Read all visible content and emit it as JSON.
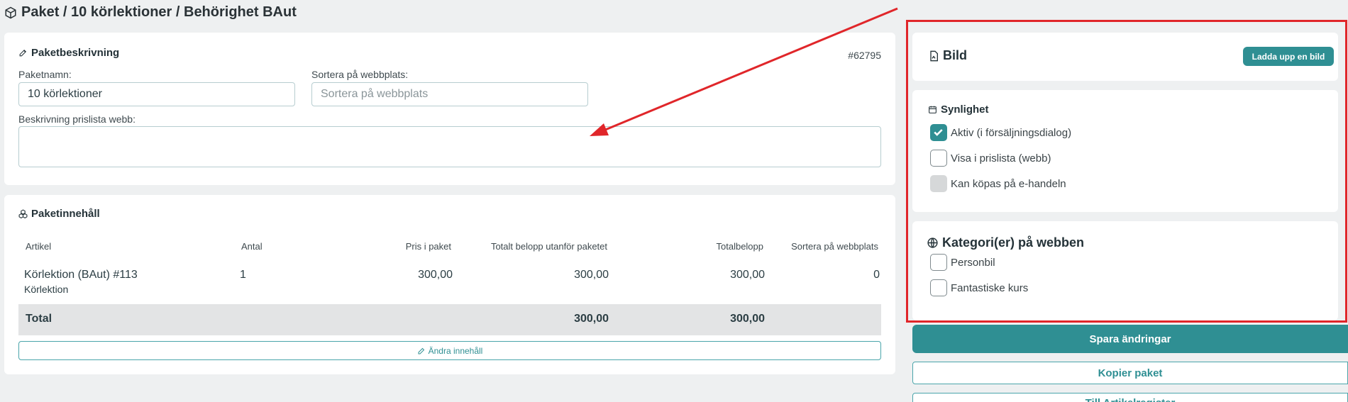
{
  "header": {
    "breadcrumb": "Paket / 10 körlektioner / Behörighet BAut"
  },
  "description": {
    "title": "Paketbeskrivning",
    "id": "#62795",
    "name_label": "Paketnamn:",
    "name_value": "10 körlektioner",
    "sort_label": "Sortera på webbplats:",
    "sort_placeholder": "Sortera på webbplats",
    "desc_label": "Beskrivning prislista webb:",
    "desc_value": ""
  },
  "content": {
    "title": "Paketinnehåll",
    "columns": [
      "Artikel",
      "Antal",
      "Pris i paket",
      "Totalt belopp utanför paketet",
      "Totalbelopp",
      "Sortera på webbplats"
    ],
    "row": {
      "article": "Körlektion (BAut) #113",
      "article_sub": "Körlektion",
      "qty": "1",
      "price": "300,00",
      "outside_total": "300,00",
      "total": "300,00",
      "sort": "0"
    },
    "total_label": "Total",
    "total_outside": "300,00",
    "total_amount": "300,00",
    "edit_button": "Ändra innehåll"
  },
  "image_card": {
    "title": "Bild",
    "upload_button": "Ladda upp en bild"
  },
  "visibility": {
    "title": "Synlighet",
    "options": [
      {
        "label": "Aktiv (i försäljningsdialog)",
        "state": "checked"
      },
      {
        "label": "Visa i prislista (webb)",
        "state": "unchecked"
      },
      {
        "label": "Kan köpas på e-handeln",
        "state": "disabled"
      }
    ]
  },
  "categories": {
    "title": "Kategori(er) på webben",
    "options": [
      {
        "label": "Personbil",
        "state": "unchecked"
      },
      {
        "label": "Fantastiske kurs",
        "state": "unchecked"
      }
    ]
  },
  "actions": {
    "save": "Spara ändringar",
    "copy": "Kopier paket",
    "back": "Till Artikelregister"
  },
  "colors": {
    "accent": "#2f8f93",
    "annotation": "#e0262a",
    "background": "#eef0f1"
  }
}
